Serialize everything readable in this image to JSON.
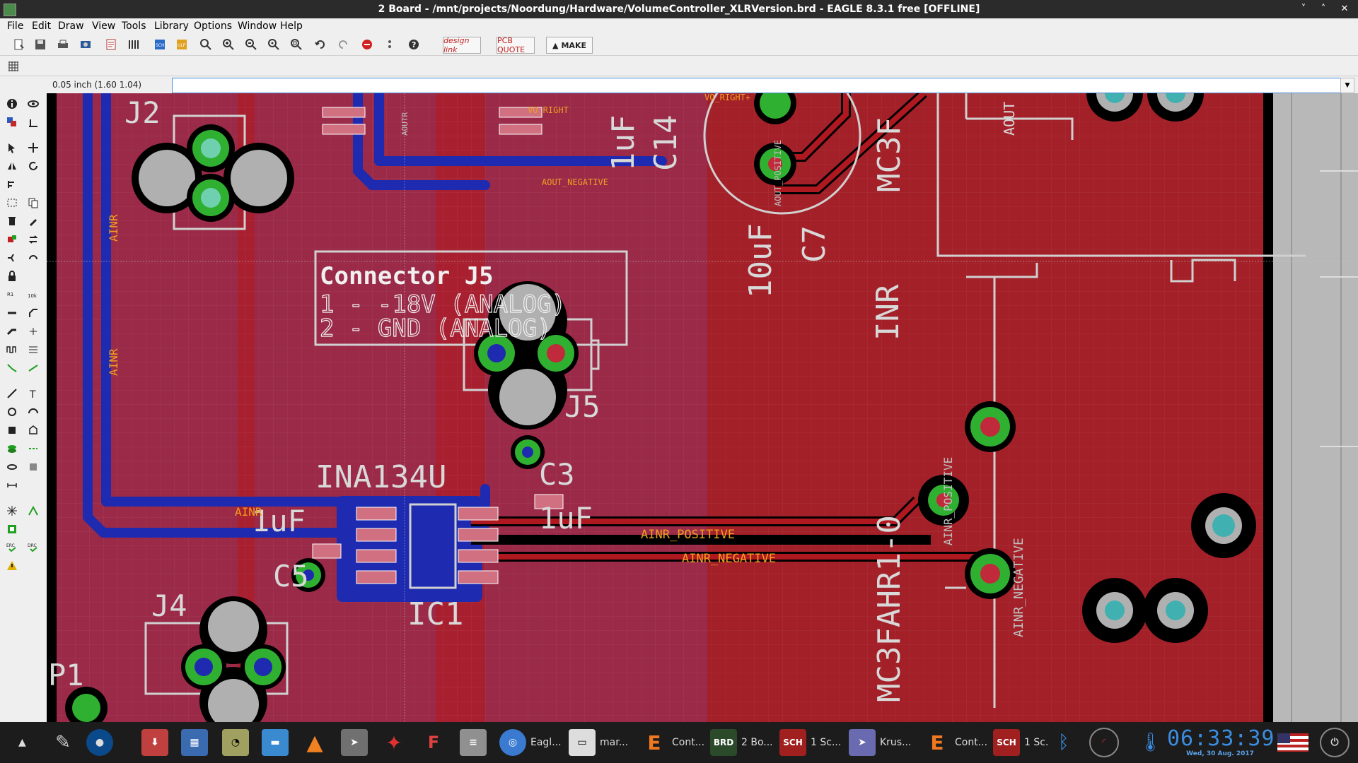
{
  "window": {
    "title": "2 Board - /mnt/projects/Noordung/Hardware/VolumeController_XLRVersion.brd - EAGLE 8.3.1 free [OFFLINE]",
    "minimize_glyph": "˅",
    "maximize_glyph": "˄",
    "close_glyph": "✕"
  },
  "menu": [
    "File",
    "Edit",
    "Draw",
    "View",
    "Tools",
    "Library",
    "Options",
    "Window",
    "Help"
  ],
  "toolbar": {
    "designlink_label": "design link",
    "pcbquote_label": "PCB QUOTE",
    "make_label": "MAKE"
  },
  "coordinate_display": "0.05 inch (1.60 1.04)",
  "command_line_value": "",
  "board": {
    "colors": {
      "background": "#000000",
      "top_copper": "#9e1a2a",
      "top_pour": "#8c2030",
      "bottom_copper": "#1b2a9a",
      "silkscreen": "#d8d8d8",
      "pad": "#30b030",
      "name_text": "#ffb020"
    },
    "silk_texts": {
      "j2": "J2",
      "j4": "J4",
      "j5": "J5",
      "p1": "P1",
      "c3": "C3",
      "c5": "C5",
      "c7": "C7",
      "c14": "C14",
      "ic1": "IC1",
      "ina": "INA134U",
      "uf1": "1uF",
      "uf2": "1uF",
      "uf3": "1uF",
      "uf10": "10uF",
      "inr": "INR",
      "mc3f_top": "MC3F",
      "mc3f_bottom": "MC3FAHR1-0",
      "aout": "AOUT"
    },
    "connector_note": {
      "title": "Connector J5",
      "line1": "1 - -18V (ANALOG)",
      "line2": "2 - GND (ANALOG)"
    },
    "net_labels": {
      "ainr1": "AINR",
      "ainr2": "AINR",
      "ainr3": "AINR",
      "ainr_positive": "AINR_POSITIVE",
      "ainr_negative": "AINR_NEGATIVE",
      "vo_right": "VO_RIGHT",
      "vo_right2": "VO_RIGHT+",
      "aout_negative": "AOUT_NEGATIVE",
      "ainr_pos_pad": "AINR_POSITIVE",
      "ainr_neg_pad": "AINR_NEGATIVE",
      "aout_pos_pad": "AOUT_POSITIVE",
      "aout_neg": "AOUTR"
    }
  },
  "taskbar": {
    "apps": [
      {
        "icon": "eagle-icon",
        "label": "Eagl..."
      },
      {
        "icon": "terminal-icon",
        "label": "mar..."
      },
      {
        "icon": "eagle-e-icon",
        "label": "Cont..."
      },
      {
        "icon": "brd-icon",
        "label": "2 Bo...",
        "badge": "BRD"
      },
      {
        "icon": "sch-icon",
        "label": "1 Sc...",
        "badge": "SCH"
      },
      {
        "icon": "krusader-icon",
        "label": "Krus..."
      },
      {
        "icon": "eagle-e-icon",
        "label": "Cont..."
      },
      {
        "icon": "sch-icon",
        "label": "1 Sc.",
        "badge": "SCH"
      }
    ],
    "clock_time": "06:33:39",
    "clock_date": "Wed, 30 Aug. 2017"
  }
}
